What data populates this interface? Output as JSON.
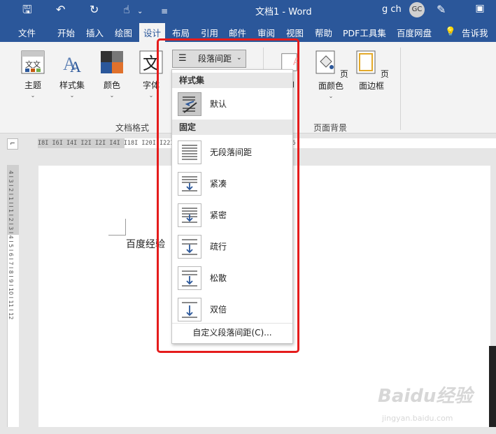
{
  "window": {
    "title": "文档1 - Word",
    "user": "g ch",
    "avatar": "GC",
    "icons": [
      "save-icon",
      "undo-icon",
      "redo-icon",
      "touch-mode-icon",
      "customize-qat-icon",
      "pen-icon",
      "ribbon-display-icon"
    ]
  },
  "tabs": [
    "文件",
    "开始",
    "插入",
    "绘图",
    "设计",
    "布局",
    "引用",
    "邮件",
    "审阅",
    "视图",
    "帮助",
    "PDF工具集",
    "百度网盘"
  ],
  "active_tab": "设计",
  "tell_me": "告诉我",
  "ribbon": {
    "buttons": {
      "theme": "主题",
      "style_set": "样式集",
      "colors": "颜色",
      "fonts": "字体",
      "para_spacing": "段落间距",
      "watermark_partial": "印",
      "page_color": "页面颜色",
      "page_border": "页面边框"
    },
    "groups": {
      "doc_format": "文档格式",
      "page_background": "页面背景"
    }
  },
  "ruler": {
    "h_text": "I8I I6I I4I I2I     I2I I4I                              I18I I20I I22I I24I I26I I28I I30I I32I I34I I36",
    "v_text": "4 I 3 I 2 I 1 I   I 1 I 2 I 3 I 4 I 5 I 6 I 7 I 8 I 9 I 10 I 11 I 12"
  },
  "document": {
    "text": "百度经验"
  },
  "dropdown": {
    "section_styleset": "样式集",
    "default": "默认",
    "section_fixed": "固定",
    "items": [
      "无段落间距",
      "紧凑",
      "紧密",
      "疏行",
      "松散",
      "双倍"
    ],
    "footer": "自定义段落间距(C)..."
  },
  "watermark": {
    "brand": "Baidu经验",
    "url": "jingyan.baidu.com"
  },
  "colors": {
    "accent": "#2b579a",
    "highlight": "#e51c1c"
  }
}
